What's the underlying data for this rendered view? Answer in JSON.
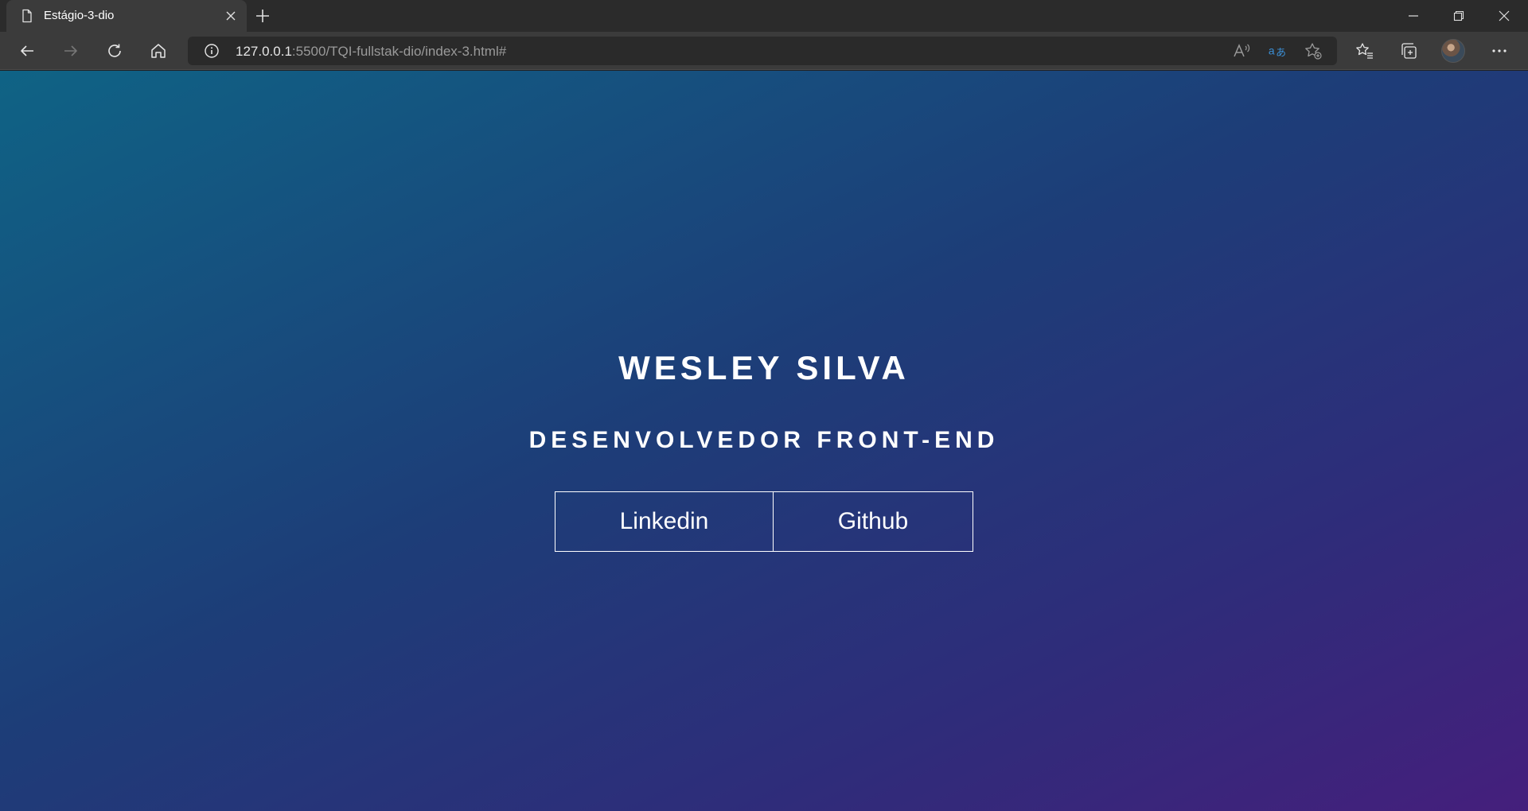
{
  "browser": {
    "tab": {
      "title": "Estágio-3-dio"
    },
    "address_bar": {
      "url_host": "127.0.0.1",
      "url_rest": ":5500/TQI-fullstak-dio/index-3.html#"
    },
    "toolbar_icons": [
      "back-icon",
      "forward-icon",
      "reload-icon",
      "home-icon",
      "info-icon",
      "read-aloud-icon",
      "translate-icon",
      "add-favorite-icon",
      "favorites-icon",
      "collections-icon",
      "profile-avatar",
      "more-icon"
    ]
  },
  "page": {
    "name": "WESLEY SILVA",
    "role": "DESENVOLVEDOR FRONT-END",
    "links": [
      {
        "label": "Linkedin"
      },
      {
        "label": "Github"
      }
    ],
    "colors": {
      "gradient_start": "#0f6385",
      "gradient_mid": "#1d3d78",
      "gradient_end": "#451f7c",
      "text": "#ffffff"
    }
  }
}
